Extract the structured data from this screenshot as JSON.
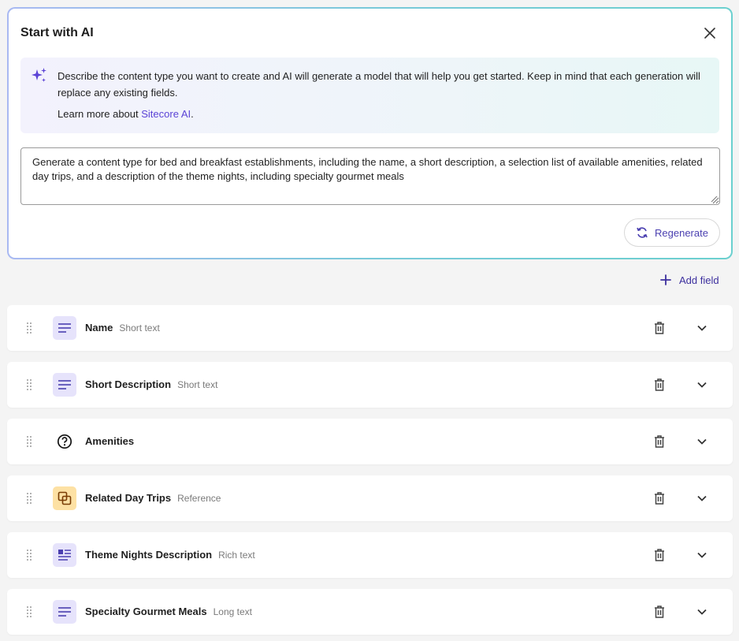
{
  "ai_panel": {
    "title": "Start with AI",
    "description": "Describe the content type you want to create and AI will generate a model that will help you get started. Keep in mind that each generation will replace any existing fields.",
    "learn_more_prefix": "Learn more about ",
    "learn_more_link": "Sitecore AI",
    "learn_more_suffix": ".",
    "prompt_value": "Generate a content type for bed and breakfast establishments, including the name, a short description, a selection list of available amenities, related day trips, and a description of the theme nights, including specialty gourmet meals",
    "regenerate_label": "Regenerate"
  },
  "add_field_label": "Add field",
  "fields": [
    {
      "name": "Name",
      "type": "Short text",
      "icon": "short-text-icon"
    },
    {
      "name": "Short Description",
      "type": "Short text",
      "icon": "short-text-icon"
    },
    {
      "name": "Amenities",
      "type": "",
      "icon": "question-circle-icon"
    },
    {
      "name": "Related Day Trips",
      "type": "Reference",
      "icon": "reference-icon"
    },
    {
      "name": "Theme Nights Description",
      "type": "Rich text",
      "icon": "rich-text-icon"
    },
    {
      "name": "Specialty Gourmet Meals",
      "type": "Long text",
      "icon": "long-text-icon"
    }
  ],
  "colors": {
    "accent": "#5b43d6",
    "text_icon_bg": "#e6e3fb",
    "reference_icon_bg": "#fde1a4"
  }
}
